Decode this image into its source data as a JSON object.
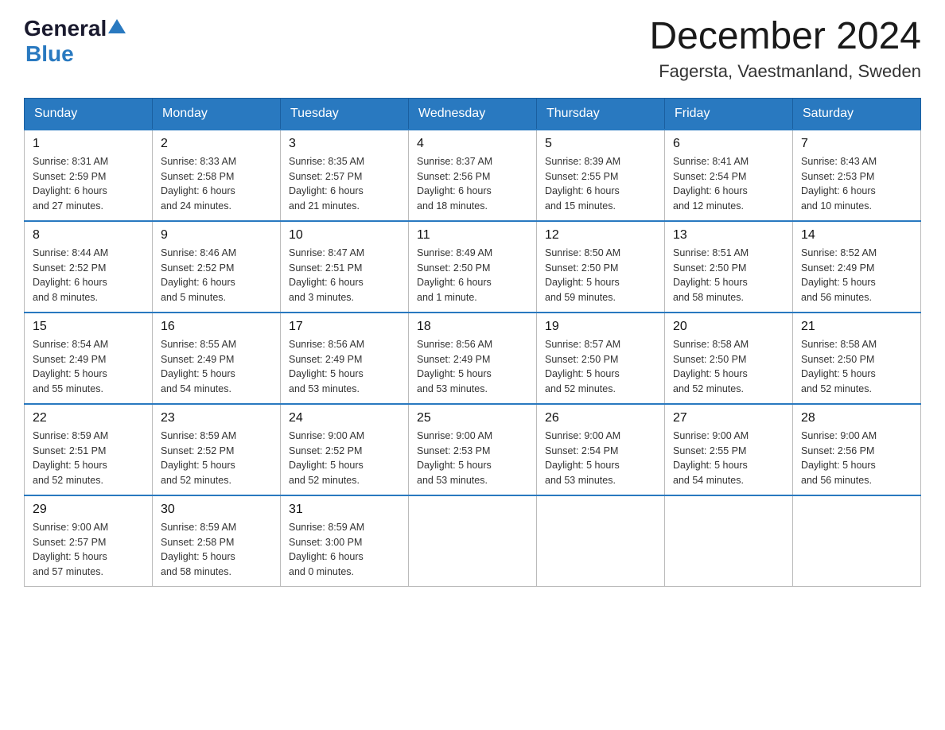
{
  "header": {
    "logo_general": "General",
    "logo_blue": "Blue",
    "title": "December 2024",
    "subtitle": "Fagersta, Vaestmanland, Sweden"
  },
  "calendar": {
    "days": [
      "Sunday",
      "Monday",
      "Tuesday",
      "Wednesday",
      "Thursday",
      "Friday",
      "Saturday"
    ],
    "weeks": [
      [
        {
          "day": "1",
          "info": "Sunrise: 8:31 AM\nSunset: 2:59 PM\nDaylight: 6 hours\nand 27 minutes."
        },
        {
          "day": "2",
          "info": "Sunrise: 8:33 AM\nSunset: 2:58 PM\nDaylight: 6 hours\nand 24 minutes."
        },
        {
          "day": "3",
          "info": "Sunrise: 8:35 AM\nSunset: 2:57 PM\nDaylight: 6 hours\nand 21 minutes."
        },
        {
          "day": "4",
          "info": "Sunrise: 8:37 AM\nSunset: 2:56 PM\nDaylight: 6 hours\nand 18 minutes."
        },
        {
          "day": "5",
          "info": "Sunrise: 8:39 AM\nSunset: 2:55 PM\nDaylight: 6 hours\nand 15 minutes."
        },
        {
          "day": "6",
          "info": "Sunrise: 8:41 AM\nSunset: 2:54 PM\nDaylight: 6 hours\nand 12 minutes."
        },
        {
          "day": "7",
          "info": "Sunrise: 8:43 AM\nSunset: 2:53 PM\nDaylight: 6 hours\nand 10 minutes."
        }
      ],
      [
        {
          "day": "8",
          "info": "Sunrise: 8:44 AM\nSunset: 2:52 PM\nDaylight: 6 hours\nand 8 minutes."
        },
        {
          "day": "9",
          "info": "Sunrise: 8:46 AM\nSunset: 2:52 PM\nDaylight: 6 hours\nand 5 minutes."
        },
        {
          "day": "10",
          "info": "Sunrise: 8:47 AM\nSunset: 2:51 PM\nDaylight: 6 hours\nand 3 minutes."
        },
        {
          "day": "11",
          "info": "Sunrise: 8:49 AM\nSunset: 2:50 PM\nDaylight: 6 hours\nand 1 minute."
        },
        {
          "day": "12",
          "info": "Sunrise: 8:50 AM\nSunset: 2:50 PM\nDaylight: 5 hours\nand 59 minutes."
        },
        {
          "day": "13",
          "info": "Sunrise: 8:51 AM\nSunset: 2:50 PM\nDaylight: 5 hours\nand 58 minutes."
        },
        {
          "day": "14",
          "info": "Sunrise: 8:52 AM\nSunset: 2:49 PM\nDaylight: 5 hours\nand 56 minutes."
        }
      ],
      [
        {
          "day": "15",
          "info": "Sunrise: 8:54 AM\nSunset: 2:49 PM\nDaylight: 5 hours\nand 55 minutes."
        },
        {
          "day": "16",
          "info": "Sunrise: 8:55 AM\nSunset: 2:49 PM\nDaylight: 5 hours\nand 54 minutes."
        },
        {
          "day": "17",
          "info": "Sunrise: 8:56 AM\nSunset: 2:49 PM\nDaylight: 5 hours\nand 53 minutes."
        },
        {
          "day": "18",
          "info": "Sunrise: 8:56 AM\nSunset: 2:49 PM\nDaylight: 5 hours\nand 53 minutes."
        },
        {
          "day": "19",
          "info": "Sunrise: 8:57 AM\nSunset: 2:50 PM\nDaylight: 5 hours\nand 52 minutes."
        },
        {
          "day": "20",
          "info": "Sunrise: 8:58 AM\nSunset: 2:50 PM\nDaylight: 5 hours\nand 52 minutes."
        },
        {
          "day": "21",
          "info": "Sunrise: 8:58 AM\nSunset: 2:50 PM\nDaylight: 5 hours\nand 52 minutes."
        }
      ],
      [
        {
          "day": "22",
          "info": "Sunrise: 8:59 AM\nSunset: 2:51 PM\nDaylight: 5 hours\nand 52 minutes."
        },
        {
          "day": "23",
          "info": "Sunrise: 8:59 AM\nSunset: 2:52 PM\nDaylight: 5 hours\nand 52 minutes."
        },
        {
          "day": "24",
          "info": "Sunrise: 9:00 AM\nSunset: 2:52 PM\nDaylight: 5 hours\nand 52 minutes."
        },
        {
          "day": "25",
          "info": "Sunrise: 9:00 AM\nSunset: 2:53 PM\nDaylight: 5 hours\nand 53 minutes."
        },
        {
          "day": "26",
          "info": "Sunrise: 9:00 AM\nSunset: 2:54 PM\nDaylight: 5 hours\nand 53 minutes."
        },
        {
          "day": "27",
          "info": "Sunrise: 9:00 AM\nSunset: 2:55 PM\nDaylight: 5 hours\nand 54 minutes."
        },
        {
          "day": "28",
          "info": "Sunrise: 9:00 AM\nSunset: 2:56 PM\nDaylight: 5 hours\nand 56 minutes."
        }
      ],
      [
        {
          "day": "29",
          "info": "Sunrise: 9:00 AM\nSunset: 2:57 PM\nDaylight: 5 hours\nand 57 minutes."
        },
        {
          "day": "30",
          "info": "Sunrise: 8:59 AM\nSunset: 2:58 PM\nDaylight: 5 hours\nand 58 minutes."
        },
        {
          "day": "31",
          "info": "Sunrise: 8:59 AM\nSunset: 3:00 PM\nDaylight: 6 hours\nand 0 minutes."
        },
        {
          "day": "",
          "info": ""
        },
        {
          "day": "",
          "info": ""
        },
        {
          "day": "",
          "info": ""
        },
        {
          "day": "",
          "info": ""
        }
      ]
    ]
  }
}
